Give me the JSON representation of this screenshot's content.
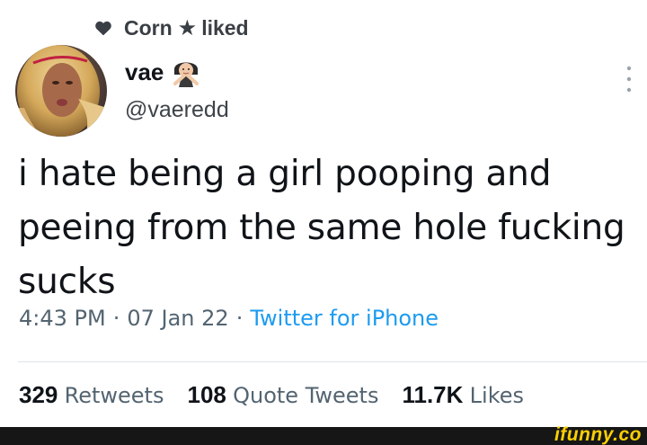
{
  "social_context": {
    "user": "Corn",
    "action": "liked",
    "heart_icon": "heart-icon",
    "star_icon": "star-icon",
    "star_glyph": "★"
  },
  "author": {
    "display_name": "vae",
    "handle": "@vaeredd",
    "name_emoji": "woman-gesturing-no-emoji",
    "avatar": "profile-avatar"
  },
  "tweet": {
    "text": "i hate being a girl pooping and\npeeing from the same hole fucking\nsucks"
  },
  "meta": {
    "time": "4:43 PM",
    "date": "07 Jan 22",
    "separator": "·",
    "source": "Twitter for iPhone"
  },
  "stats": [
    {
      "count": "329",
      "label": "Retweets"
    },
    {
      "count": "108",
      "label": "Quote Tweets"
    },
    {
      "count": "11.7K",
      "label": "Likes"
    }
  ],
  "watermark": {
    "text": "ifunny.co"
  },
  "colors": {
    "link": "#1d9bf0",
    "secondary_text": "#536471",
    "primary_text": "#0f1419",
    "watermark": "#fccf03",
    "footer_bar": "#161616"
  }
}
